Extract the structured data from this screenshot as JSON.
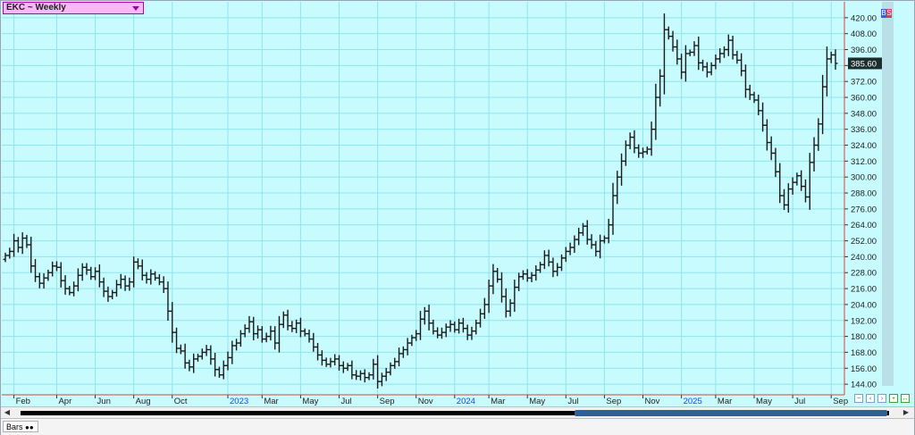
{
  "symbol": {
    "label": "EKC ~ Weekly"
  },
  "corner_badges": [
    "B",
    "S"
  ],
  "price_label": "385.60",
  "bottom_tab": {
    "label": "Bars"
  },
  "colors": {
    "background": "#c8fbfd",
    "grid": "#8fe4ee",
    "bars": "#1a1a1a",
    "axis_line": "#e04040",
    "year_label": "#1f3fff",
    "price_box": "#1c2d2d"
  },
  "chart_data": {
    "type": "ohlc-bar",
    "title": "EKC ~ Weekly",
    "ylim": [
      136,
      432
    ],
    "y_ticks": [
      144,
      156,
      168,
      180,
      192,
      204,
      216,
      228,
      240,
      252,
      264,
      276,
      288,
      300,
      312,
      324,
      336,
      348,
      360,
      372,
      384,
      396,
      408,
      420
    ],
    "y_tick_labels": [
      "144.00",
      "156.00",
      "168.00",
      "180.00",
      "192.00",
      "204.00",
      "216.00",
      "228.00",
      "240.00",
      "252.00",
      "264.00",
      "276.00",
      "288.00",
      "300.00",
      "312.00",
      "324.00",
      "336.00",
      "348.00",
      "360.00",
      "372.00",
      "384.00",
      "396.00",
      "408.00",
      "420.00"
    ],
    "x_labels": [
      {
        "label": "Feb",
        "index": 2,
        "year": false
      },
      {
        "label": "Apr",
        "index": 12,
        "year": false
      },
      {
        "label": "Jun",
        "index": 21,
        "year": false
      },
      {
        "label": "Aug",
        "index": 30,
        "year": false
      },
      {
        "label": "Oct",
        "index": 39,
        "year": false
      },
      {
        "label": "2023",
        "index": 52,
        "year": true
      },
      {
        "label": "Mar",
        "index": 60,
        "year": false
      },
      {
        "label": "May",
        "index": 69,
        "year": false
      },
      {
        "label": "Jul",
        "index": 78,
        "year": false
      },
      {
        "label": "Sep",
        "index": 87,
        "year": false
      },
      {
        "label": "Nov",
        "index": 96,
        "year": false
      },
      {
        "label": "2024",
        "index": 105,
        "year": true
      },
      {
        "label": "Mar",
        "index": 113,
        "year": false
      },
      {
        "label": "May",
        "index": 122,
        "year": false
      },
      {
        "label": "Jul",
        "index": 131,
        "year": false
      },
      {
        "label": "Sep",
        "index": 140,
        "year": false
      },
      {
        "label": "Nov",
        "index": 149,
        "year": false
      },
      {
        "label": "2025",
        "index": 158,
        "year": true
      },
      {
        "label": "Mar",
        "index": 166,
        "year": false
      },
      {
        "label": "May",
        "index": 175,
        "year": false
      },
      {
        "label": "Jul",
        "index": 184,
        "year": false
      },
      {
        "label": "Sep",
        "index": 193,
        "year": false
      }
    ],
    "closes": [
      241,
      244,
      252,
      247,
      254,
      249,
      233,
      225,
      220,
      224,
      228,
      233,
      232,
      222,
      216,
      213,
      218,
      226,
      232,
      230,
      225,
      229,
      221,
      214,
      210,
      213,
      219,
      223,
      218,
      221,
      236,
      233,
      226,
      223,
      227,
      224,
      221,
      216,
      199,
      183,
      171,
      169,
      160,
      157,
      163,
      165,
      168,
      170,
      163,
      155,
      151,
      158,
      164,
      173,
      175,
      182,
      186,
      191,
      182,
      185,
      178,
      180,
      184,
      175,
      189,
      196,
      188,
      186,
      190,
      184,
      182,
      178,
      172,
      166,
      162,
      159,
      161,
      163,
      158,
      156,
      158,
      151,
      150,
      152,
      149,
      151,
      159,
      146,
      150,
      153,
      158,
      161,
      167,
      170,
      175,
      179,
      182,
      193,
      199,
      190,
      184,
      181,
      183,
      187,
      189,
      185,
      190,
      186,
      181,
      184,
      190,
      197,
      204,
      218,
      229,
      223,
      210,
      199,
      205,
      217,
      225,
      227,
      224,
      226,
      230,
      234,
      241,
      236,
      229,
      232,
      239,
      244,
      247,
      253,
      258,
      263,
      253,
      249,
      244,
      252,
      254,
      264,
      286,
      300,
      312,
      324,
      330,
      322,
      318,
      319,
      321,
      336,
      360,
      376,
      411,
      406,
      398,
      389,
      379,
      393,
      394,
      399,
      386,
      383,
      379,
      384,
      389,
      393,
      396,
      403,
      392,
      388,
      380,
      366,
      362,
      358,
      350,
      339,
      326,
      318,
      304,
      286,
      279,
      291,
      296,
      301,
      293,
      285,
      311,
      324,
      340,
      368,
      389,
      392,
      385.6
    ],
    "series_note_shown": false
  }
}
